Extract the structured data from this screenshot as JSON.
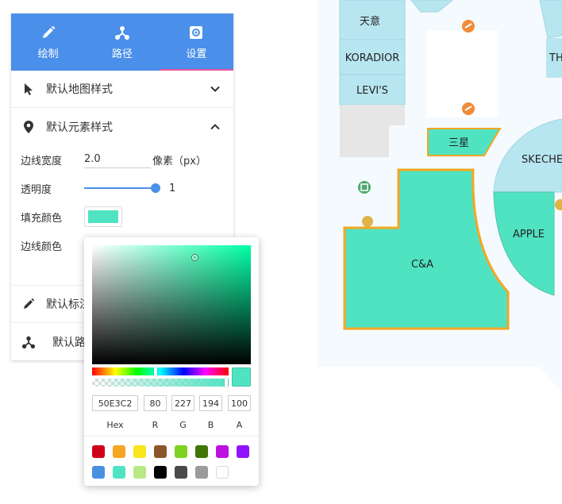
{
  "tabs": [
    {
      "label": "绘制",
      "icon": "pencil-icon"
    },
    {
      "label": "路径",
      "icon": "route-icon"
    },
    {
      "label": "设置",
      "icon": "gear-icon",
      "active": true
    }
  ],
  "sections": {
    "map_style": {
      "label": "默认地图样式",
      "icon": "cursor-icon",
      "expanded": false
    },
    "element_style": {
      "label": "默认元素样式",
      "icon": "map-pin-icon",
      "expanded": true,
      "border_width": {
        "label": "边线宽度",
        "value": "2.0",
        "unit": "像素（px）"
      },
      "opacity": {
        "label": "透明度",
        "value": "1",
        "fraction": 1.0
      },
      "fill_color": {
        "label": "填充颜色",
        "color": "#50e3c2"
      },
      "border_color": {
        "label": "边线颜色"
      }
    },
    "label_style": {
      "label": "默认标注样式",
      "icon": "pencil-icon"
    },
    "route_style": {
      "label": "默认路径样式",
      "icon": "route-icon"
    }
  },
  "color_picker": {
    "current_color": "#50e3c2",
    "hex": "50E3C2",
    "r": "80",
    "g": "227",
    "b": "194",
    "a": "100",
    "labels": {
      "hex": "Hex",
      "r": "R",
      "g": "G",
      "b": "B",
      "a": "A"
    },
    "presets": [
      "#d0021b",
      "#f5a623",
      "#f8e71c",
      "#8b572a",
      "#7ed321",
      "#417505",
      "#bd10e0",
      "#9013fe",
      "#4a90e2",
      "#50e3c2",
      "#b8e986",
      "#000000",
      "#4a4a4a",
      "#9b9b9b",
      "#ffffff"
    ]
  },
  "map": {
    "shops": [
      "天意",
      "KORADIOR",
      "LEVI'S",
      "三星",
      "SKECHE",
      "APPLE",
      "C&A",
      "TH"
    ],
    "colors": {
      "selected_fill": "#50e3c2",
      "selected_border": "#f5a623",
      "shop_fill": "#b8e6f0",
      "floor": "#f4fafd",
      "gray": "#e6e6e6",
      "poi": "#f08c3a"
    }
  }
}
